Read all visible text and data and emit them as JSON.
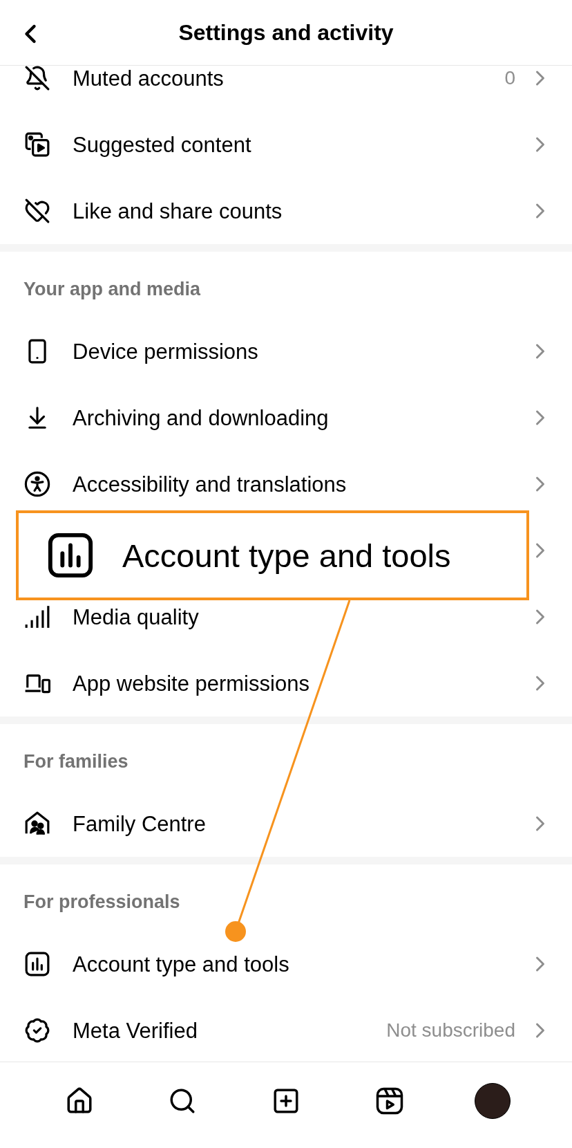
{
  "header": {
    "title": "Settings and activity"
  },
  "sections": [
    {
      "items": [
        {
          "label": "Muted accounts",
          "value": "0"
        },
        {
          "label": "Suggested content"
        },
        {
          "label": "Like and share counts"
        }
      ]
    },
    {
      "heading": "Your app and media",
      "items": [
        {
          "label": "Device permissions"
        },
        {
          "label": "Archiving and downloading"
        },
        {
          "label": "Accessibility and translations"
        },
        {
          "covered": true
        },
        {
          "label": "Media quality"
        },
        {
          "label": "App website permissions"
        }
      ]
    },
    {
      "heading": "For families",
      "items": [
        {
          "label": "Family Centre"
        }
      ]
    },
    {
      "heading": "For professionals",
      "items": [
        {
          "label": "Account type and tools"
        },
        {
          "label": "Meta Verified",
          "value": "Not subscribed"
        }
      ]
    }
  ],
  "callout": {
    "label": "Account type and tools"
  },
  "tab_bar": {
    "items": [
      {
        "kind": "home"
      },
      {
        "kind": "search"
      },
      {
        "kind": "create"
      },
      {
        "kind": "reels"
      },
      {
        "kind": "profile"
      }
    ]
  }
}
